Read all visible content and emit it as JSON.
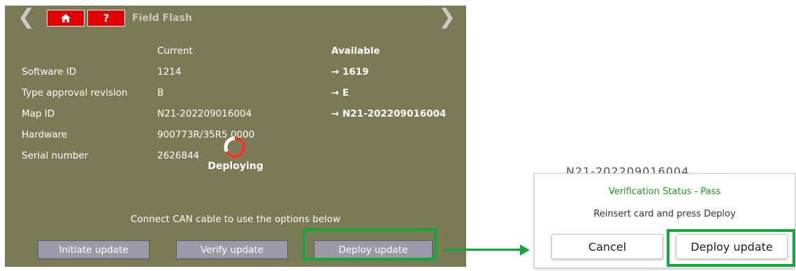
{
  "screen": {
    "title": "Field Flash",
    "nav_back_glyph": "❮",
    "nav_forward_glyph": "❯",
    "home_icon": "home-icon",
    "help_label": "?",
    "headers": {
      "current": "Current",
      "available": "Available"
    },
    "rows": [
      {
        "label": "Software ID",
        "current": "1214",
        "available": "→ 1619"
      },
      {
        "label": "Type approval revision",
        "current": "B",
        "available": "→ E"
      },
      {
        "label": "Map ID",
        "current": "N21-202209016004",
        "available": "→ N21-202209016004"
      },
      {
        "label": "Hardware",
        "current": "900773R/35R5 0000",
        "available": ""
      },
      {
        "label": "Serial number",
        "current": "2626844",
        "available": ""
      }
    ],
    "deploying_text": "Deploying",
    "connect_text": "Connect CAN cable to use the options below",
    "buttons": {
      "initiate": "Initiate update",
      "verify": "Verify update",
      "deploy": "Deploy update"
    },
    "colors": {
      "background": "#7a7a55",
      "top_button": "#e00000",
      "action_button": "#9a9aa8",
      "highlight": "#13a83a"
    }
  },
  "dialog": {
    "background_text": "N21-202209016004",
    "status": "Verification Status - Pass",
    "message": "Reinsert card and press Deploy",
    "cancel_label": "Cancel",
    "deploy_label": "Deploy update",
    "status_color": "#1e9a1e"
  }
}
